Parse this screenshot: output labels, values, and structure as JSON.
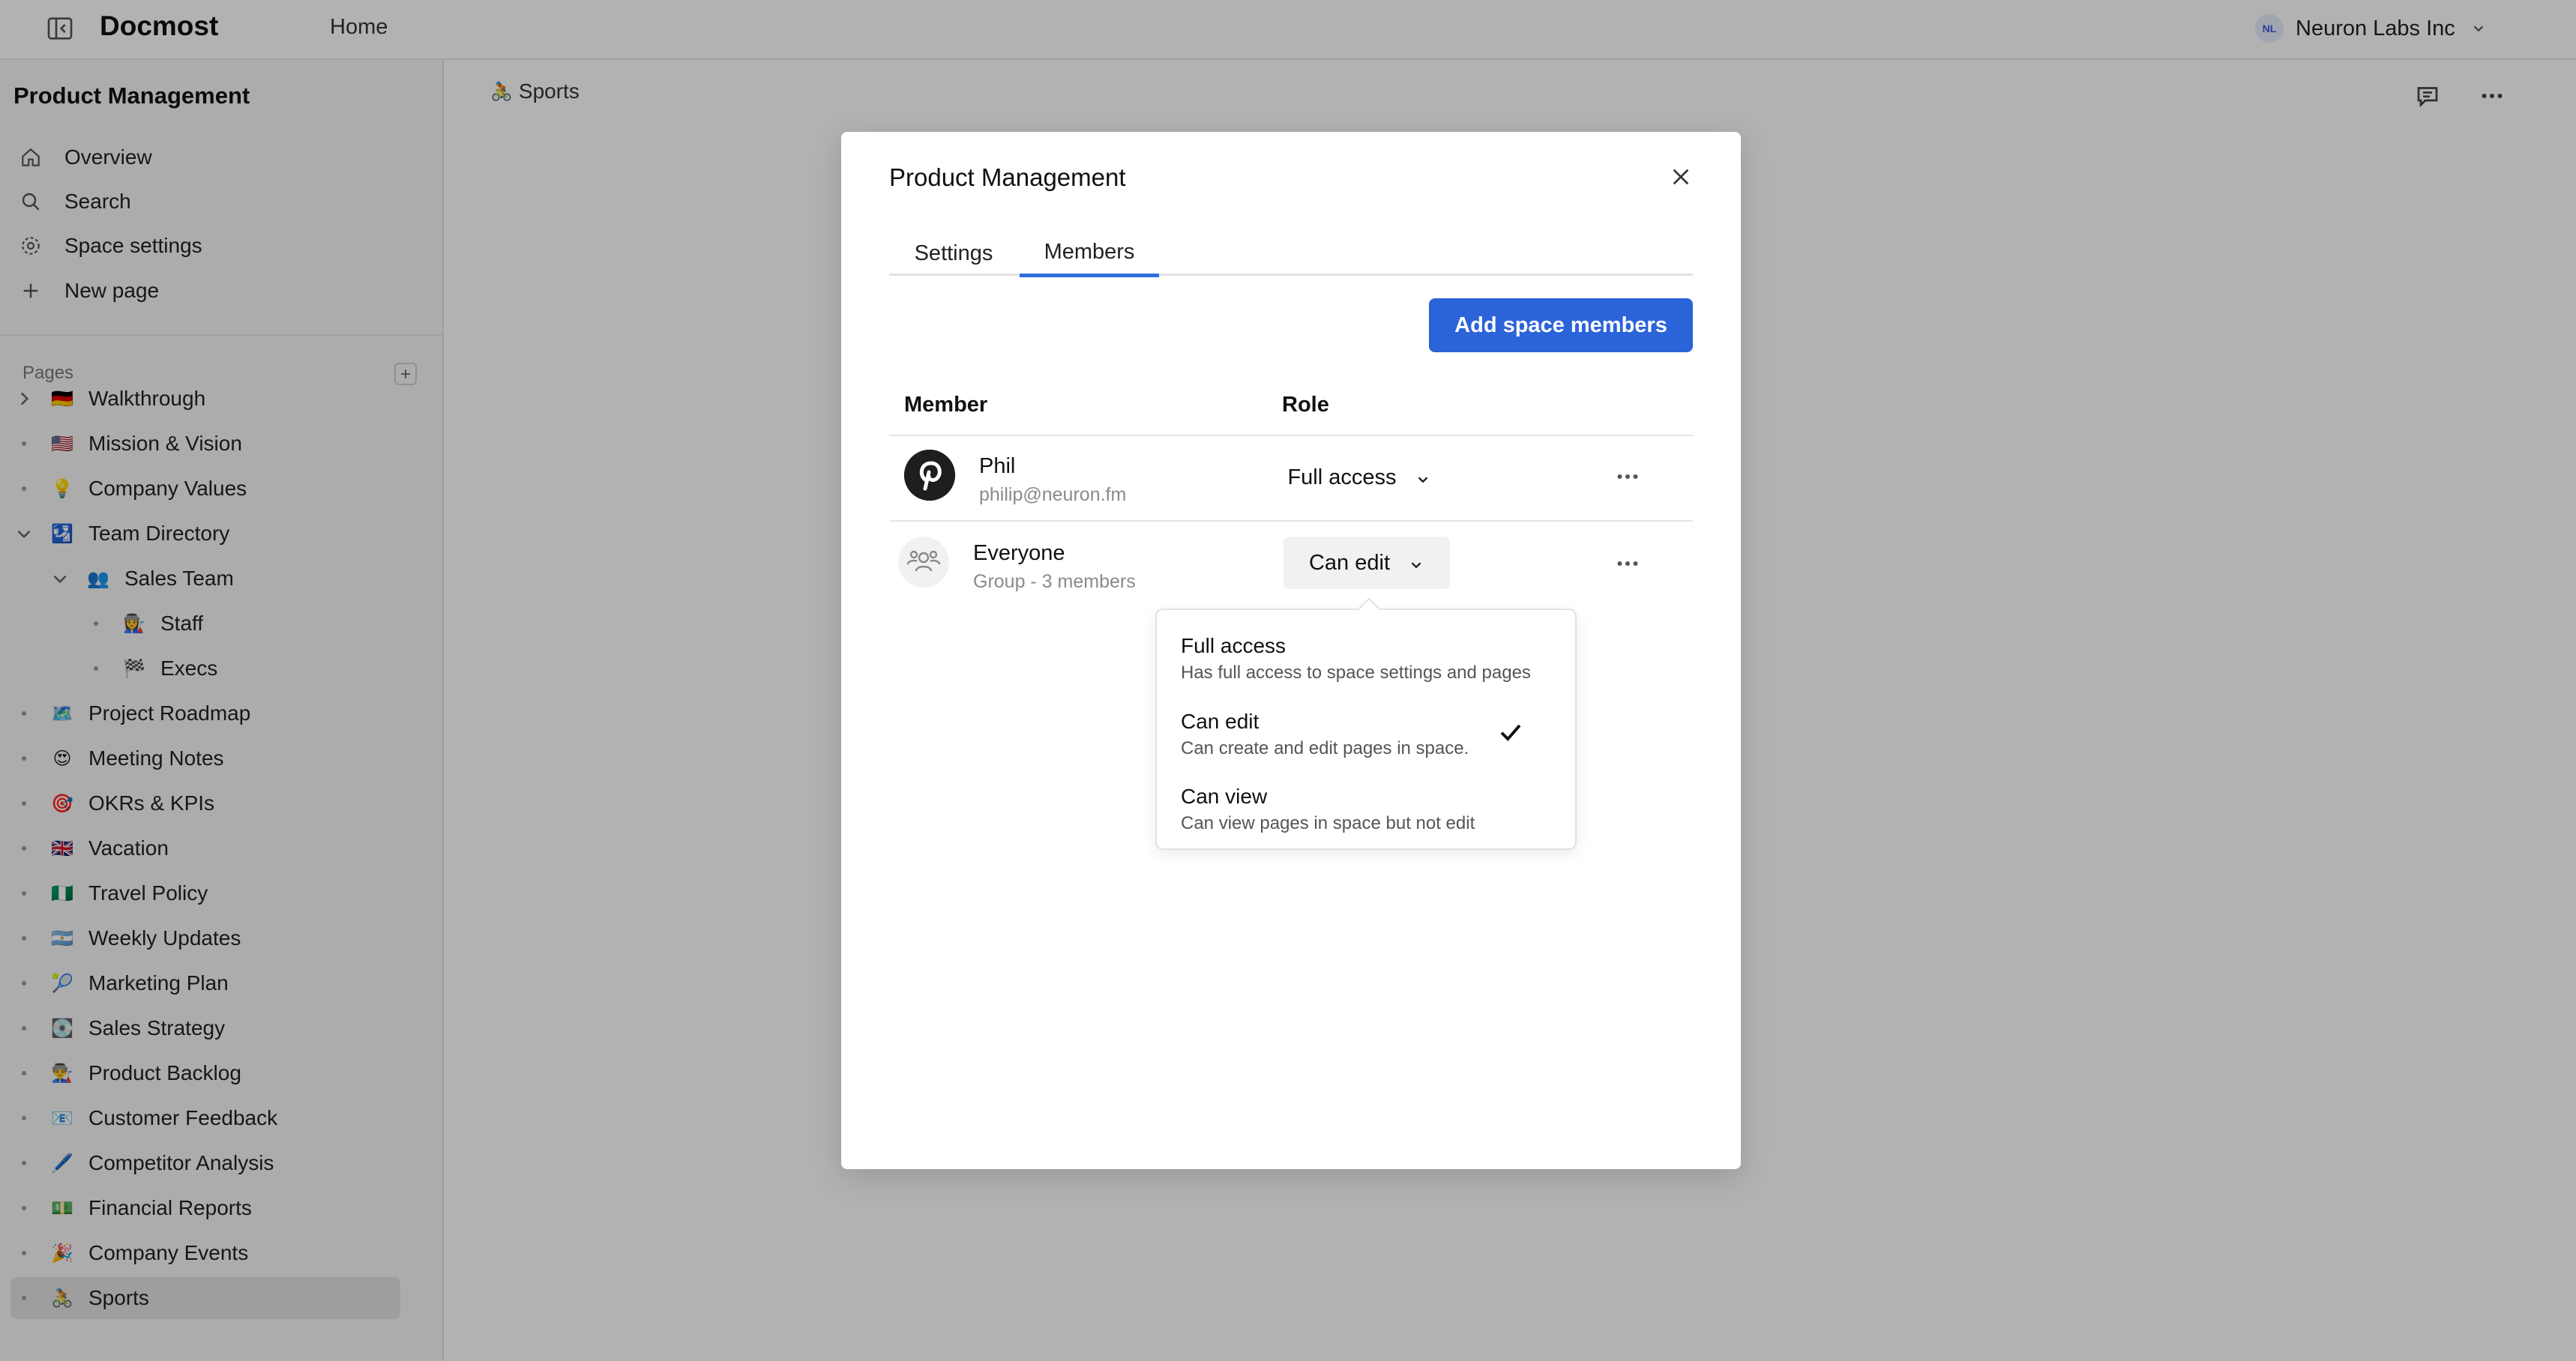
{
  "header": {
    "brand": "Docmost",
    "home": "Home",
    "workspace": {
      "initials": "NL",
      "name": "Neuron Labs Inc"
    }
  },
  "sidebar": {
    "space_title": "Product Management",
    "nav": [
      {
        "label": "Overview",
        "icon": "home-icon"
      },
      {
        "label": "Search",
        "icon": "search-icon"
      },
      {
        "label": "Space settings",
        "icon": "gear-icon"
      },
      {
        "label": "New page",
        "icon": "plus-icon"
      }
    ],
    "pages_label": "Pages",
    "pages": [
      {
        "label": "Walkthrough",
        "emoji": "🇩🇪",
        "lead": "chevron-right"
      },
      {
        "label": "Mission & Vision",
        "emoji": "🇺🇸",
        "lead": "dot"
      },
      {
        "label": "Company Values",
        "emoji": "💡",
        "lead": "dot"
      },
      {
        "label": "Team Directory",
        "emoji": "🛂",
        "lead": "chevron-down"
      },
      {
        "label": "Sales Team",
        "emoji": "👥",
        "lead": "chevron-down"
      },
      {
        "label": "Staff",
        "emoji": "👩‍🏭",
        "lead": "dot"
      },
      {
        "label": "Execs",
        "emoji": "🏁",
        "lead": "dot"
      },
      {
        "label": "Project Roadmap",
        "emoji": "🗺️",
        "lead": "dot"
      },
      {
        "label": "Meeting Notes",
        "emoji": "😍",
        "lead": "dot"
      },
      {
        "label": "OKRs & KPIs",
        "emoji": "🎯",
        "lead": "dot"
      },
      {
        "label": "Vacation",
        "emoji": "🇬🇧",
        "lead": "dot"
      },
      {
        "label": "Travel Policy",
        "emoji": "🇳🇬",
        "lead": "dot"
      },
      {
        "label": "Weekly Updates",
        "emoji": "🇦🇷",
        "lead": "dot"
      },
      {
        "label": "Marketing Plan",
        "emoji": "🎾",
        "lead": "dot"
      },
      {
        "label": "Sales Strategy",
        "emoji": "💽",
        "lead": "dot"
      },
      {
        "label": "Product Backlog",
        "emoji": "👨‍🏭",
        "lead": "dot"
      },
      {
        "label": "Customer Feedback",
        "emoji": "📧",
        "lead": "dot"
      },
      {
        "label": "Competitor Analysis",
        "emoji": "🖊️",
        "lead": "dot"
      },
      {
        "label": "Financial Reports",
        "emoji": "💵",
        "lead": "dot"
      },
      {
        "label": "Company Events",
        "emoji": "🎉",
        "lead": "dot"
      },
      {
        "label": "Sports",
        "emoji": "🚴",
        "lead": "dot"
      }
    ]
  },
  "main": {
    "breadcrumb": {
      "emoji": "🚴",
      "label": "Sports"
    }
  },
  "modal": {
    "title": "Product Management",
    "tabs": [
      {
        "label": "Settings"
      },
      {
        "label": "Members"
      }
    ],
    "active_tab": "Members",
    "add_button": "Add space members",
    "columns": {
      "member": "Member",
      "role": "Role"
    },
    "members": [
      {
        "name": "Phil",
        "sub": "philip@neuron.fm",
        "role": "Full access",
        "avatar": "pinterest-avatar-icon"
      },
      {
        "name": "Everyone",
        "sub": "Group - 3 members",
        "role": "Can edit",
        "avatar": "group-icon"
      }
    ]
  },
  "role_menu": {
    "options": [
      {
        "label": "Full access",
        "desc": "Has full access to space settings and pages"
      },
      {
        "label": "Can edit",
        "desc": "Can create and edit pages in space.",
        "selected": true
      },
      {
        "label": "Can view",
        "desc": "Can view pages in space but not edit"
      }
    ]
  },
  "colors": {
    "primary": "#2b63d9",
    "tab_indicator": "#2f6fdc",
    "overlay": "rgba(0,0,0,0.30)"
  }
}
